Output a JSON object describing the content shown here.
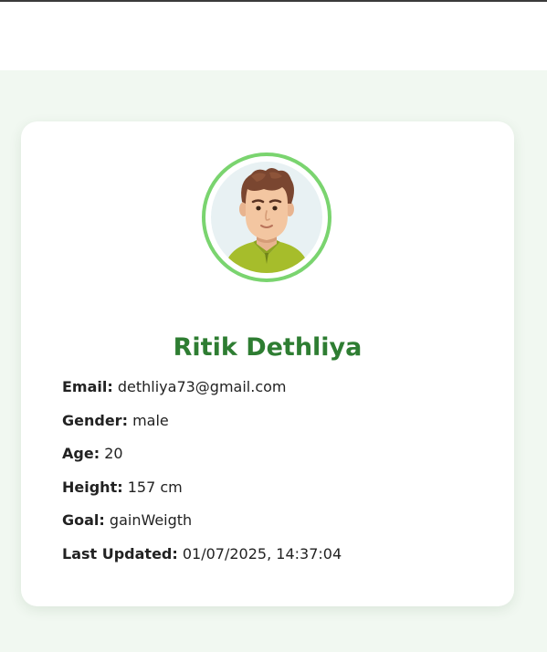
{
  "profile": {
    "name": "Ritik Dethliya",
    "avatar_icon": "user-avatar-illustration",
    "fields": [
      {
        "label": "Email:",
        "value": "dethliya73@gmail.com"
      },
      {
        "label": "Gender:",
        "value": "male"
      },
      {
        "label": "Age:",
        "value": "20"
      },
      {
        "label": "Height:",
        "value": "157 cm"
      },
      {
        "label": "Goal:",
        "value": "gainWeigth"
      },
      {
        "label": "Last Updated:",
        "value": "01/07/2025, 14:37:04"
      }
    ]
  },
  "colors": {
    "page_bg": "#f1f8f1",
    "name": "#2e7d32",
    "avatar_ring": "#7ad46f"
  }
}
